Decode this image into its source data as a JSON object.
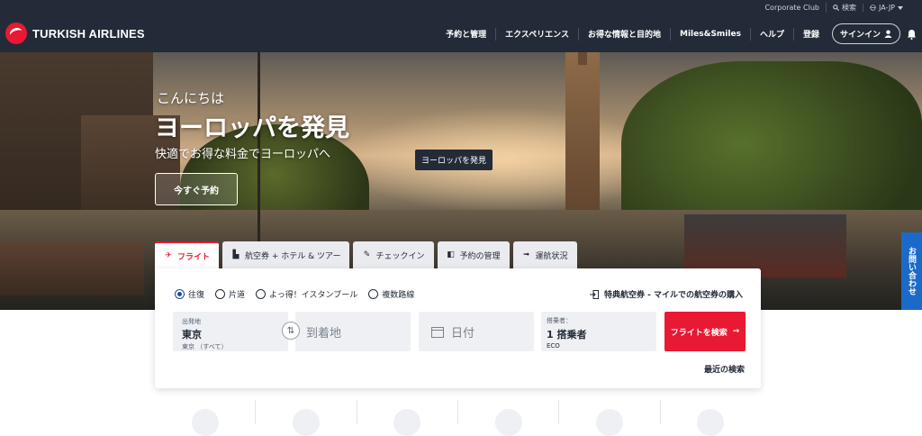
{
  "util_bar": {
    "corporate_club": "Corporate Club",
    "search": "検索",
    "language": "JA-JP"
  },
  "brand": {
    "name": "TURKISH AIRLINES",
    "accent": "#e81932",
    "nav_bg": "#232b38"
  },
  "nav": {
    "items": [
      "予約と管理",
      "エクスペリエンス",
      "お得な情報と目的地",
      "Miles&Smiles",
      "ヘルプ",
      "登録"
    ],
    "signin_label": "サインイン"
  },
  "hero": {
    "greeting": "こんにちは",
    "title": "ヨーロッパを発見",
    "subtitle": "快適でお得な料金でヨーロッパへ",
    "cta": "今すぐ予約",
    "tooltip": "ヨーロッパを発見"
  },
  "feedback_label": "お問い合わせ",
  "tabs": [
    {
      "label": "フライト",
      "icon": "plane-icon",
      "active": true
    },
    {
      "label": "航空券 + ホテル & ツアー",
      "icon": "hotel-icon",
      "active": false
    },
    {
      "label": "チェックイン",
      "icon": "checkin-icon",
      "active": false
    },
    {
      "label": "予約の管理",
      "icon": "manage-icon",
      "active": false
    },
    {
      "label": "運航状況",
      "icon": "status-icon",
      "active": false
    }
  ],
  "trip_types": [
    {
      "label": "往復",
      "selected": true
    },
    {
      "label": "片道",
      "selected": false
    },
    {
      "label": "よっ得！イスタンブール",
      "selected": false
    },
    {
      "label": "複数路線",
      "selected": false
    }
  ],
  "award_link": "特典航空券 - マイルでの航空券の購入",
  "search": {
    "from": {
      "label": "出発地",
      "value": "東京",
      "detail": "東京 （すべて）"
    },
    "to_placeholder": "到着地",
    "date_placeholder": "日付",
    "passengers": {
      "label": "搭乗者：",
      "value": "1 搭乗者",
      "cabin": "ECO"
    },
    "button": "フライトを検索"
  },
  "recent_searches": "最近の検索"
}
